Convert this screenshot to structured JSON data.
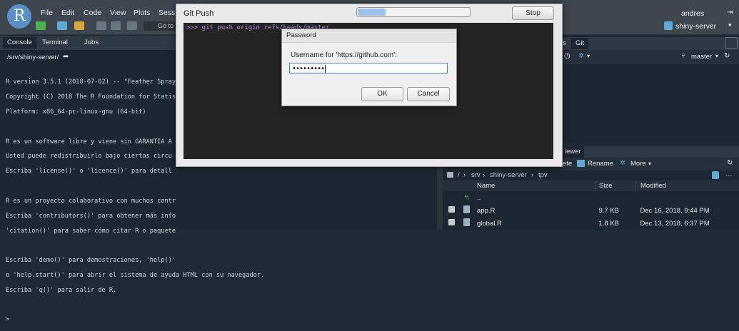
{
  "menubar": {
    "items": [
      "File",
      "Edit",
      "Code",
      "View",
      "Plots",
      "Sessi"
    ],
    "goto_label": "Go to",
    "user": "andres",
    "project": "shiny-server"
  },
  "console_pane": {
    "tabs": [
      "Console",
      "Terminal",
      "Jobs"
    ],
    "path": "/srv/shiny-server/",
    "lines": [
      "R version 3.5.1 (2018-07-02) -- \"Feather Spray\"",
      "Copyright (C) 2018 The R Foundation for Statis",
      "Platform: x86_64-pc-linux-gnu (64-bit)",
      "",
      "R es un software libre y viene sin GARANTIA A",
      "Usted puede redistribuirlo bajo ciertas circu",
      "Escriba 'license()' o 'licence()' para detall",
      "",
      "R es un proyecto colaborativo con muchos contr",
      "Escriba 'contributors()' para obtener más info",
      "'citation()' para saber cómo citar R o paquete",
      "",
      "Escriba 'demo()' para demostraciones, 'help()'",
      "o 'help.start()' para abrir el sistema de ayuda HTML con su navegador.",
      "Escriba 'q()' para salir de R.",
      "",
      ">"
    ]
  },
  "git_pane": {
    "tab_partial": "s",
    "tab_git": "Git",
    "branch": "master"
  },
  "files_pane": {
    "tab_partial": "iewer",
    "toolbar": {
      "rename_partial": "ete",
      "rename": "Rename",
      "more": "More"
    },
    "breadcrumb": [
      "/",
      "srv",
      "shiny-server",
      "tpv"
    ],
    "columns": {
      "name": "Name",
      "size": "Size",
      "modified": "Modified"
    },
    "rows": [
      {
        "name": "..",
        "size": "",
        "modified": ""
      },
      {
        "name": "app.R",
        "size": "9.7 KB",
        "modified": "Dec 16, 2018, 9:44 PM"
      },
      {
        "name": "global.R",
        "size": "1.8 KB",
        "modified": "Dec 13, 2018, 6:37 PM"
      }
    ]
  },
  "git_push_dialog": {
    "title": "Git Push",
    "stop_label": "Stop",
    "command": ">>> git push origin refs/heads/master",
    "progress": 0.25
  },
  "password_dialog": {
    "title": "Password",
    "label": "Username for 'https://github.com':",
    "value": "•••••••••",
    "ok_label": "OK",
    "cancel_label": "Cancel"
  },
  "colors": {
    "accent": "#5a8fc8",
    "command": "#b08cd8",
    "input_focus": "#4a7fd0"
  }
}
